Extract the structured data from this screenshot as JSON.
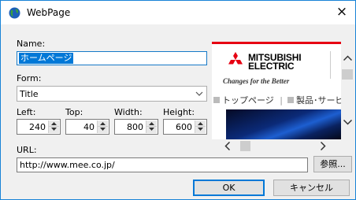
{
  "window": {
    "title": "WebPage",
    "close_glyph": "×"
  },
  "form": {
    "name_label": "Name:",
    "name_value": "ホームページ",
    "form_label": "Form:",
    "form_value": "Title",
    "left_label": "Left:",
    "left_value": "240",
    "top_label": "Top:",
    "top_value": "40",
    "width_label": "Width:",
    "width_value": "800",
    "height_label": "Height:",
    "height_value": "600",
    "url_label": "URL:",
    "url_value": "http://www.mee.co.jp/"
  },
  "buttons": {
    "browse": "参照...",
    "ok": "OK",
    "cancel": "キャンセル"
  },
  "preview": {
    "brand_line1": "MITSUBISHI",
    "brand_line2": "ELECTRIC",
    "tagline": "Changes for the Better",
    "nav_item1": "トップページ",
    "nav_sep": "|",
    "nav_item2": "製品･サービ"
  },
  "colors": {
    "accent": "#0078d7",
    "brand_red": "#e60012"
  }
}
